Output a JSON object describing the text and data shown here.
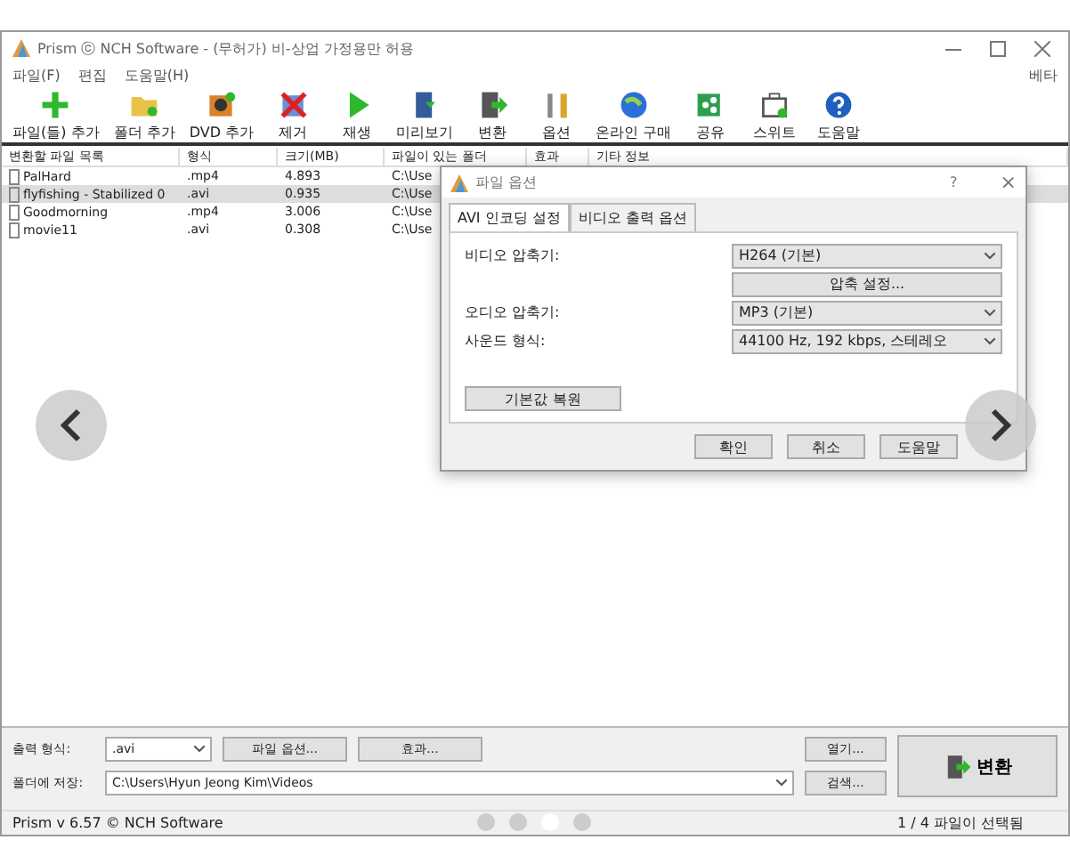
{
  "window": {
    "title": "Prism ⓒ NCH Software - (무허가) 비-상업 가정용만 허용"
  },
  "menu": [
    "파일(F)",
    "편집",
    "도움말(H)"
  ],
  "menu_right": "베타",
  "toolbar": [
    {
      "label": "파일(들) 추가",
      "kind": "plus"
    },
    {
      "label": "폴더 추가",
      "kind": "folder"
    },
    {
      "label": "DVD 추가",
      "kind": "disc"
    },
    {
      "label": "제거",
      "kind": "remove"
    },
    {
      "label": "재생",
      "kind": "play"
    },
    {
      "label": "미리보기",
      "kind": "film"
    },
    {
      "label": "변환",
      "kind": "convert"
    },
    {
      "label": "옵션",
      "kind": "tools"
    },
    {
      "label": "온라인 구매",
      "kind": "globe"
    },
    {
      "label": "공유",
      "kind": "share"
    },
    {
      "label": "스위트",
      "kind": "case"
    },
    {
      "label": "도움말",
      "kind": "help"
    }
  ],
  "table": {
    "columns": [
      "변환할 파일 목록",
      "형식",
      "크기(MB)",
      "파일이 있는 폴더",
      "효과",
      "기타 정보"
    ],
    "rows": [
      {
        "cells": [
          "PalHard",
          ".mp4",
          "4.893",
          "C:\\Use"
        ],
        "selected": false
      },
      {
        "cells": [
          "flyfishing - Stabilized 0",
          ".avi",
          "0.935",
          "C:\\Use"
        ],
        "selected": true
      },
      {
        "cells": [
          "Goodmorning",
          ".mp4",
          "3.006",
          "C:\\Use"
        ],
        "selected": false
      },
      {
        "cells": [
          "movie11",
          ".avi",
          "0.308",
          "C:\\Use"
        ],
        "selected": false
      }
    ]
  },
  "dialog": {
    "title": "파일 옵션",
    "help_glyph": "?",
    "close_glyph": "×",
    "tabs": [
      {
        "label": "AVI 인코딩 설정",
        "selected": true
      },
      {
        "label": "비디오 출력 옵션",
        "selected": false
      }
    ],
    "video_label": "비디오 압축기:",
    "video_value": "H264 (기본)",
    "compress_button": "압축 설정...",
    "audio_label": "오디오 압축기:",
    "audio_value": "MP3 (기본)",
    "sound_label": "사운드 형식:",
    "sound_value": "44100 Hz, 192 kbps, 스테레오",
    "reset_button": "기본값 복원",
    "buttons": [
      "확인",
      "취소",
      "도움말"
    ]
  },
  "bottom": {
    "format_label": "출력 형식:",
    "format_value": ".avi",
    "file_options": "파일 옵션...",
    "effects": "효과...",
    "open": "열기...",
    "save_label": "폴더에 저장:",
    "save_value": "C:\\Users\\Hyun Jeong Kim\\Videos",
    "browse": "검색...",
    "convert": "변환"
  },
  "status_bar": {
    "left": "Prism v 6.57 © NCH Software",
    "right": "1 / 4 파일이 선택됨"
  },
  "carousel": {
    "dots": [
      {
        "selected": false
      },
      {
        "selected": false
      },
      {
        "selected": true
      },
      {
        "selected": false
      }
    ]
  }
}
